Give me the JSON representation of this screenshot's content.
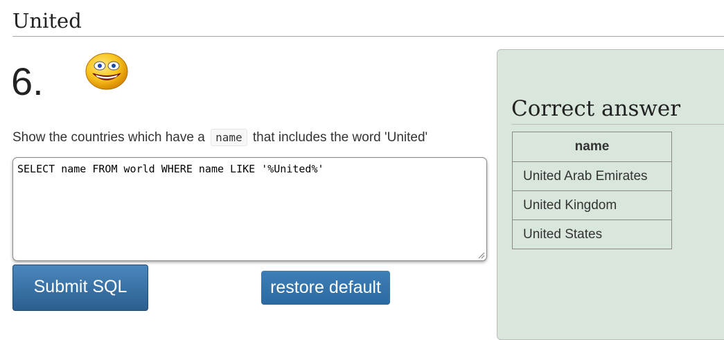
{
  "heading": "United",
  "question": {
    "number": "6.",
    "text_before": "Show the countries which have a",
    "code": "name",
    "text_after": "that includes the word 'United'"
  },
  "sql": "SELECT name FROM world WHERE name LIKE '%United%'",
  "buttons": {
    "submit_label": "Submit SQL",
    "restore_label": "restore default"
  },
  "answer": {
    "title": "Correct answer",
    "column": "name",
    "rows": [
      "United Arab Emirates",
      "United Kingdom",
      "United States"
    ]
  },
  "colors": {
    "panel_background": "#d9e6dc",
    "button_blue": "#2b5f8f"
  },
  "icons": [
    "smiley-icon"
  ]
}
